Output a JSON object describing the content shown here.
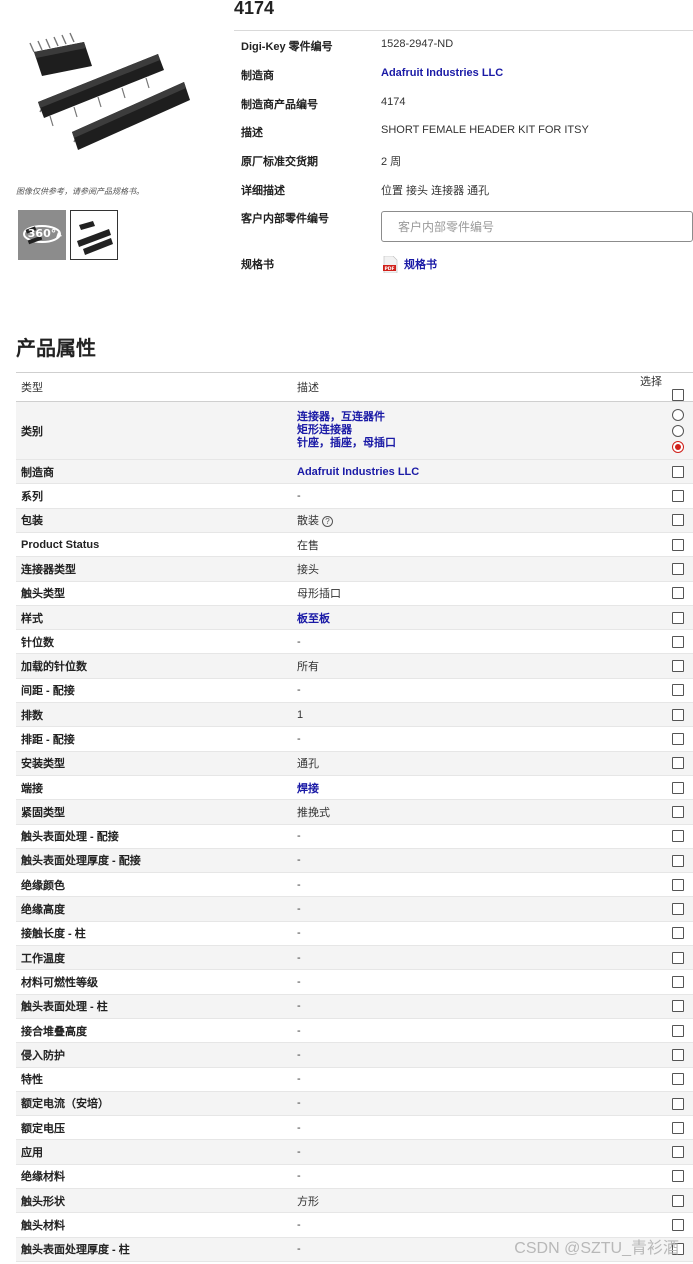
{
  "part_number_title": "4174",
  "image_note": "图像仅供参考，请参阅产品规格书。",
  "thumbnails": {
    "view_360_label": "360°"
  },
  "info": [
    {
      "label": "Digi-Key 零件编号",
      "value": "1528-2947-ND",
      "link": false
    },
    {
      "label": "制造商",
      "value": "Adafruit Industries LLC",
      "link": true
    },
    {
      "label": "制造商产品编号",
      "value": "4174",
      "link": false
    },
    {
      "label": "描述",
      "value": "SHORT FEMALE HEADER KIT FOR ITSY",
      "link": false
    },
    {
      "label": "原厂标准交货期",
      "value": "2 周",
      "link": false
    },
    {
      "label": "详细描述",
      "value": "位置 接头 连接器 通孔",
      "link": false
    }
  ],
  "customer_ref": {
    "label": "客户内部零件编号",
    "placeholder": "客户内部零件编号"
  },
  "datasheet": {
    "label": "规格书",
    "link_text": "规格书"
  },
  "attributes": {
    "title": "产品属性",
    "headers": {
      "type": "类型",
      "desc": "描述",
      "select": "选择"
    },
    "category": {
      "label": "类别",
      "values": [
        "连接器，互连器件",
        "矩形连接器",
        "针座，插座，母插口"
      ],
      "selected_index": 2
    },
    "rows": [
      {
        "type": "制造商",
        "desc": "Adafruit Industries LLC",
        "link": true
      },
      {
        "type": "系列",
        "desc": "-",
        "link": false
      },
      {
        "type": "包装",
        "desc": "散装",
        "link": false,
        "help": true
      },
      {
        "type": "Product Status",
        "desc": "在售",
        "link": false
      },
      {
        "type": "连接器类型",
        "desc": "接头",
        "link": false
      },
      {
        "type": "触头类型",
        "desc": "母形插口",
        "link": false
      },
      {
        "type": "样式",
        "desc": "板至板",
        "link": true
      },
      {
        "type": "针位数",
        "desc": "-",
        "link": false
      },
      {
        "type": "加载的针位数",
        "desc": "所有",
        "link": false
      },
      {
        "type": "间距 - 配接",
        "desc": "-",
        "link": false
      },
      {
        "type": "排数",
        "desc": "1",
        "link": false
      },
      {
        "type": "排距 - 配接",
        "desc": "-",
        "link": false
      },
      {
        "type": "安装类型",
        "desc": "通孔",
        "link": false
      },
      {
        "type": "端接",
        "desc": "焊接",
        "link": true
      },
      {
        "type": "紧固类型",
        "desc": "推挽式",
        "link": false
      },
      {
        "type": "触头表面处理 - 配接",
        "desc": "-",
        "link": false
      },
      {
        "type": "触头表面处理厚度 - 配接",
        "desc": "-",
        "link": false
      },
      {
        "type": "绝缘颜色",
        "desc": "-",
        "link": false
      },
      {
        "type": "绝缘高度",
        "desc": "-",
        "link": false
      },
      {
        "type": "接触长度 - 柱",
        "desc": "-",
        "link": false
      },
      {
        "type": "工作温度",
        "desc": "-",
        "link": false
      },
      {
        "type": "材料可燃性等级",
        "desc": "-",
        "link": false
      },
      {
        "type": "触头表面处理 - 柱",
        "desc": "-",
        "link": false
      },
      {
        "type": "接合堆叠高度",
        "desc": "-",
        "link": false
      },
      {
        "type": "侵入防护",
        "desc": "-",
        "link": false
      },
      {
        "type": "特性",
        "desc": "-",
        "link": false
      },
      {
        "type": "额定电流（安培）",
        "desc": "-",
        "link": false
      },
      {
        "type": "额定电压",
        "desc": "-",
        "link": false
      },
      {
        "type": "应用",
        "desc": "-",
        "link": false
      },
      {
        "type": "绝缘材料",
        "desc": "-",
        "link": false
      },
      {
        "type": "触头形状",
        "desc": "方形",
        "link": false
      },
      {
        "type": "触头材料",
        "desc": "-",
        "link": false
      },
      {
        "type": "触头表面处理厚度 - 柱",
        "desc": "-",
        "link": false
      }
    ]
  },
  "watermark": "CSDN @SZTU_青衫酒",
  "colors": {
    "link": "#1a1aa6",
    "radio_selected": "#d0201a",
    "row_stripe": "#f4f4f4"
  }
}
